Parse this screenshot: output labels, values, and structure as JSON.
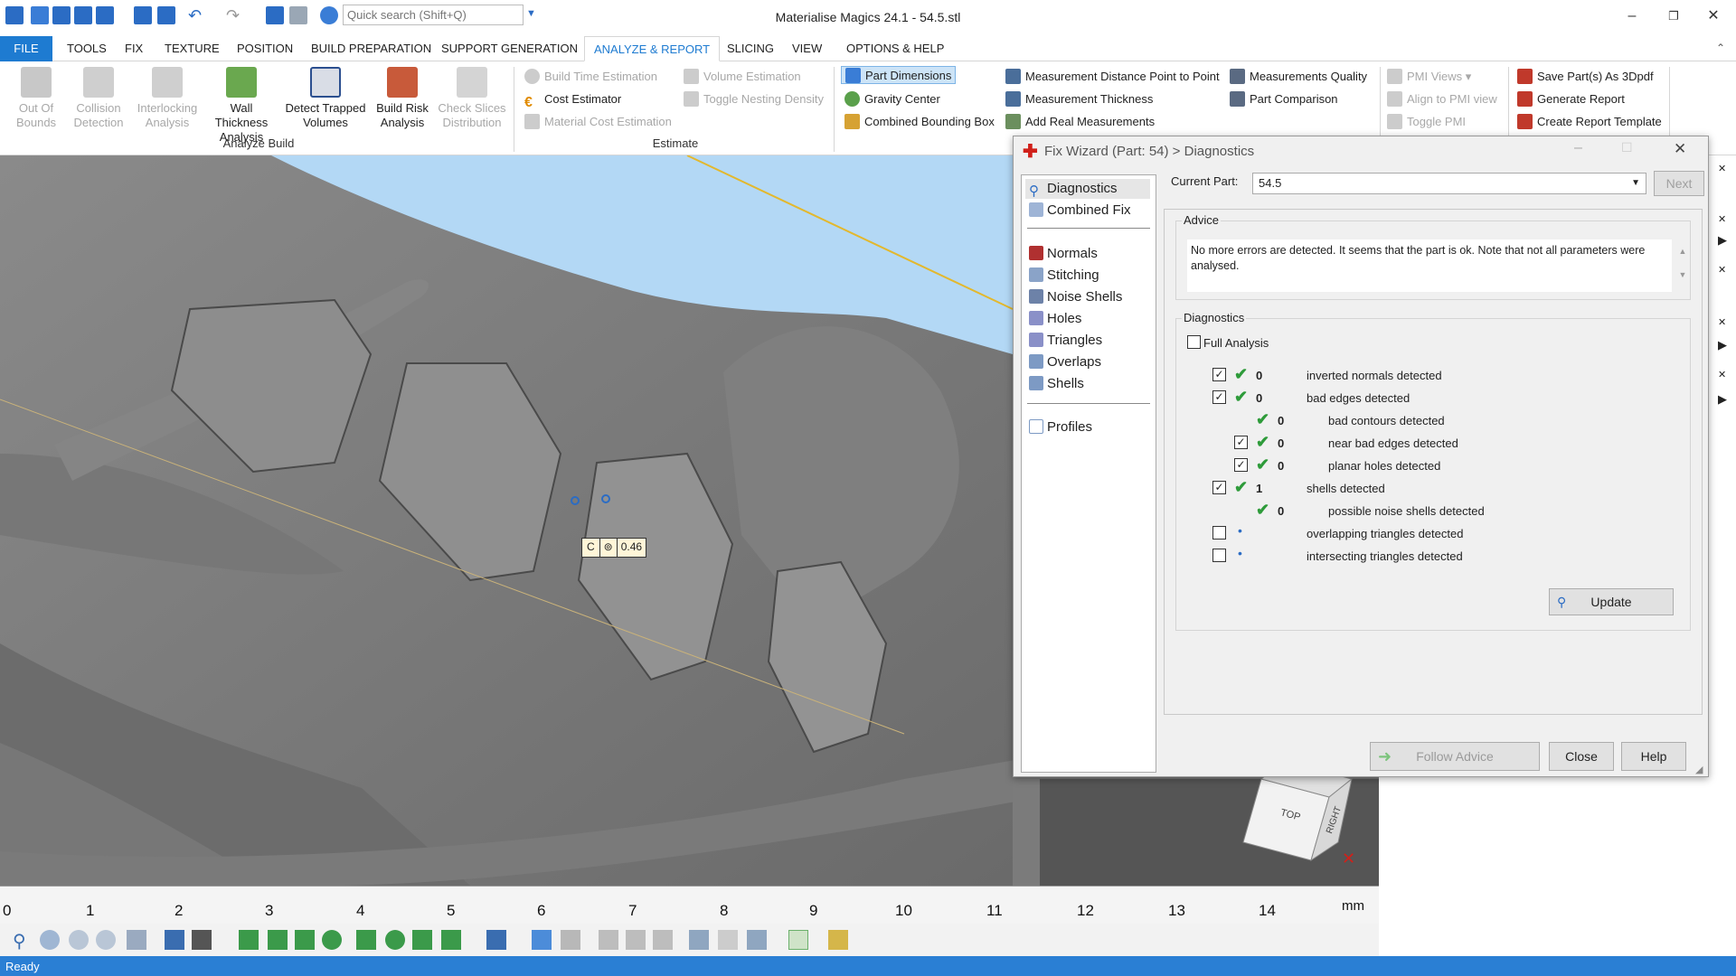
{
  "app": {
    "title": "Materialise Magics 24.1 - 54.5.stl",
    "quick_search_placeholder": "Quick search (Shift+Q)",
    "status": "Ready"
  },
  "menu": [
    "FILE",
    "TOOLS",
    "FIX",
    "TEXTURE",
    "POSITION",
    "BUILD PREPARATION",
    "SUPPORT GENERATION",
    "ANALYZE & REPORT",
    "SLICING",
    "VIEW",
    "OPTIONS & HELP"
  ],
  "ribbon": {
    "analyze_build": {
      "label": "Analyze Build",
      "items": [
        {
          "l1": "Out Of",
          "l2": "Bounds"
        },
        {
          "l1": "Collision",
          "l2": "Detection"
        },
        {
          "l1": "Interlocking",
          "l2": "Analysis"
        },
        {
          "l1": "Wall Thickness",
          "l2": "Analysis"
        },
        {
          "l1": "Detect Trapped",
          "l2": "Volumes"
        },
        {
          "l1": "Build Risk",
          "l2": "Analysis"
        },
        {
          "l1": "Check Slices",
          "l2": "Distribution"
        }
      ]
    },
    "estimate": {
      "label": "Estimate",
      "items": [
        "Build Time Estimation",
        "Cost Estimator",
        "Material Cost Estimation",
        "Volume Estimation",
        "Toggle Nesting Density"
      ]
    },
    "measure": [
      "Part Dimensions",
      "Gravity Center",
      "Combined Bounding Box",
      "Measurement Distance Point to Point",
      "Measurement Thickness",
      "Add Real Measurements",
      "Measurements Quality",
      "Part Comparison"
    ],
    "pmi": [
      "PMI Views",
      "Align to PMI view",
      "Toggle PMI"
    ],
    "report": [
      "Save Part(s) As 3Dpdf",
      "Generate Report",
      "Create Report Template"
    ]
  },
  "viewport": {
    "measurement_tag": {
      "c": "C",
      "sym": "⊚",
      "value": "0.46"
    },
    "viewcube": {
      "top": "TOP",
      "right": "RIGHT"
    },
    "ruler": {
      "ticks": [
        "0",
        "1",
        "2",
        "3",
        "4",
        "5",
        "6",
        "7",
        "8",
        "9",
        "10",
        "11",
        "12",
        "13",
        "14"
      ],
      "unit": "mm"
    }
  },
  "dialog": {
    "title": "Fix Wizard (Part: 54) > Diagnostics",
    "nav": [
      "Diagnostics",
      "Combined Fix",
      "Normals",
      "Stitching",
      "Noise Shells",
      "Holes",
      "Triangles",
      "Overlaps",
      "Shells",
      "Profiles"
    ],
    "current_part_label": "Current Part:",
    "current_part_value": "54.5",
    "next_label": "Next",
    "advice_title": "Advice",
    "advice_text": "No more errors are detected. It seems that the part is ok. Note that not all parameters were analysed.",
    "diagnostics_title": "Diagnostics",
    "full_analysis_label": "Full Analysis",
    "rows": [
      {
        "checked": true,
        "count": "0",
        "text": "inverted normals detected",
        "indent": false
      },
      {
        "checked": true,
        "count": "0",
        "text": "bad edges detected",
        "indent": false
      },
      {
        "checked": null,
        "count": "0",
        "text": "bad contours detected",
        "indent": true
      },
      {
        "checked": true,
        "count": "0",
        "text": "near bad edges detected",
        "indent": true
      },
      {
        "checked": true,
        "count": "0",
        "text": "planar holes detected",
        "indent": true
      },
      {
        "checked": true,
        "count": "1",
        "text": "shells detected",
        "indent": false
      },
      {
        "checked": null,
        "count": "0",
        "text": "possible noise shells detected",
        "indent": true
      },
      {
        "checked": false,
        "count": "",
        "text": "overlapping triangles detected",
        "indent": false
      },
      {
        "checked": false,
        "count": "",
        "text": "intersecting triangles detected",
        "indent": false
      }
    ],
    "update_label": "Update",
    "follow_advice_label": "Follow Advice",
    "close_label": "Close",
    "help_label": "Help"
  },
  "colors": {
    "accent": "#1e7bd1",
    "statusbar": "#2a7fd4",
    "viewport_bg": "#b3d8f5",
    "check_green": "#2e9b3a"
  }
}
